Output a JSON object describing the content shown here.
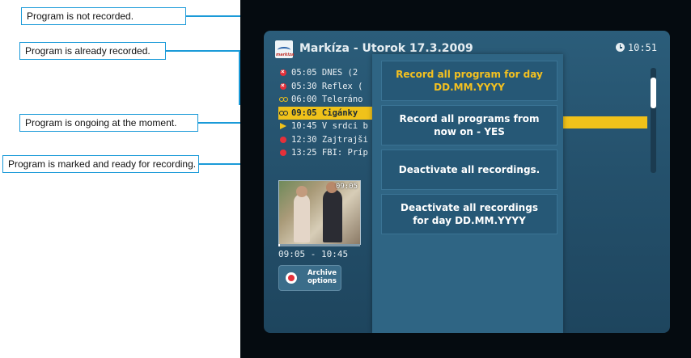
{
  "callouts": [
    {
      "text": "Program is not recorded."
    },
    {
      "text": "Program is already recorded."
    },
    {
      "text": "Program is ongoing at the moment."
    },
    {
      "text": "Program is marked and ready for recording."
    }
  ],
  "header": {
    "channel_logo_text": "markiza",
    "title": "Markíza - Utorok 17.3.2009",
    "clock": "10:51"
  },
  "programs": [
    {
      "label": "05:05 DNES (2",
      "status": "not-recorded"
    },
    {
      "label": "05:30 Reflex (",
      "status": "not-recorded"
    },
    {
      "label": "06:00 Teleráno",
      "status": "recorded"
    },
    {
      "label": "09:05 Cigánky",
      "status": "recorded-highlighted"
    },
    {
      "label": "10:45 V srdci b",
      "status": "ongoing"
    },
    {
      "label": "12:30 Zajtrajši",
      "status": "marked"
    },
    {
      "label": "13:25 FBI: Príp",
      "status": "marked"
    }
  ],
  "preview": {
    "time": "09:05",
    "progress": 0.02,
    "time_range": "09:05 - 10:45"
  },
  "archive_button": {
    "label_line1": "Archive",
    "label_line2": "options"
  },
  "menu": [
    {
      "line1": "Record all program for day",
      "line2": "DD.MM.YYYY",
      "selected": true
    },
    {
      "line1": "Record all programs from",
      "line2": "now on - YES",
      "selected": false
    },
    {
      "line1": "Deactivate all recordings.",
      "line2": "",
      "selected": false
    },
    {
      "line1": "Deactivate all recordings",
      "line2": "for day DD.MM.YYYY",
      "selected": false
    }
  ],
  "colors": {
    "accent_yellow": "#f0c21a",
    "callout_border": "#1a9ad8",
    "record_red": "#e5303a"
  }
}
